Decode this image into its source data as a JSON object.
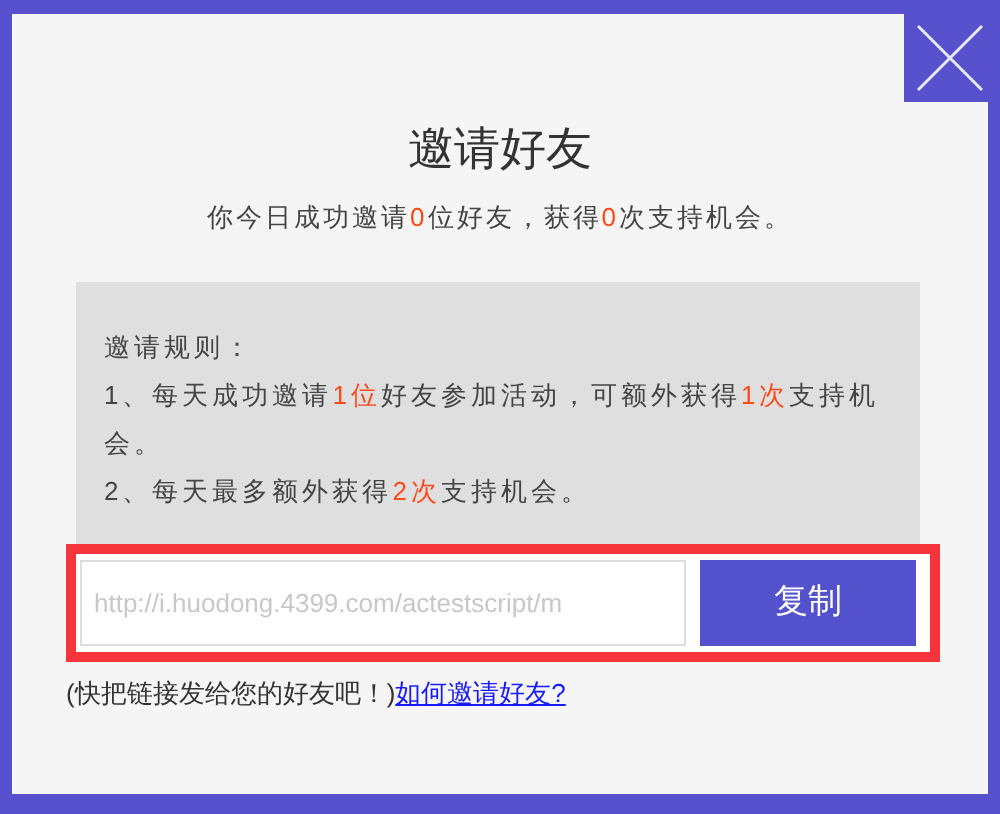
{
  "dialog": {
    "title": "邀请好友",
    "summary": [
      {
        "text": "你今日成功邀请",
        "highlight": false
      },
      {
        "text": "0",
        "highlight": true
      },
      {
        "text": "位好友，获得",
        "highlight": false
      },
      {
        "text": "0",
        "highlight": true
      },
      {
        "text": "次支持机会。",
        "highlight": false
      }
    ],
    "rules_heading": "邀请规则：",
    "rules": [
      [
        {
          "text": "1、每天成功邀请",
          "highlight": false
        },
        {
          "text": "1位",
          "highlight": true
        },
        {
          "text": "好友参加活动，可额外获得",
          "highlight": false
        },
        {
          "text": "1次",
          "highlight": true
        },
        {
          "text": "支持机会。",
          "highlight": false
        }
      ],
      [
        {
          "text": "2、每天最多额外获得",
          "highlight": false
        },
        {
          "text": "2次",
          "highlight": true
        },
        {
          "text": "支持机会。",
          "highlight": false
        }
      ]
    ],
    "link_field": {
      "value": "http://i.huodong.4399.com/actestscript/m"
    },
    "copy_button": "复制",
    "hint": "(快把链接发给您的好友吧！)",
    "help_link": "如何邀请好友?"
  }
}
